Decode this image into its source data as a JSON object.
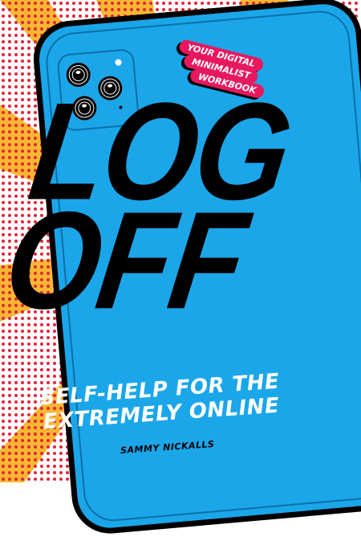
{
  "cover": {
    "badge_lines": [
      "YOUR DIGITAL",
      "MINIMALIST",
      "WORKBOOK"
    ],
    "title_lines": [
      "LOG",
      "OFF"
    ],
    "subtitle_lines": [
      "SELF-HELP FOR THE",
      "EXTREMELY ONLINE"
    ],
    "author": "SAMMY NICKALLS"
  },
  "colors": {
    "phone": "#1ba6ea",
    "badge": "#e8185f",
    "dots": "#e0263a",
    "rays": "#f7b731"
  },
  "icons": [
    "camera-lens-icon",
    "flash-icon"
  ]
}
